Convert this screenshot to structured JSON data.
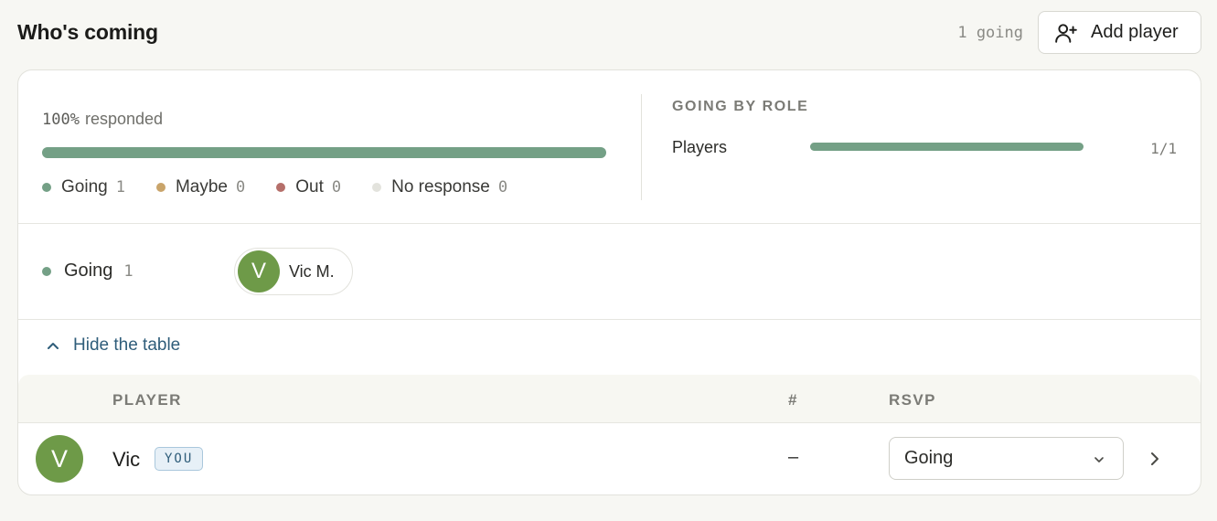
{
  "header": {
    "title": "Who's coming",
    "going_count": "1 going",
    "add_player_label": "Add player"
  },
  "summary": {
    "percent": "100%",
    "responded_label": "responded",
    "responded_fraction": 1.0,
    "legend": [
      {
        "label": "Going",
        "count": "1",
        "color": "#74a086"
      },
      {
        "label": "Maybe",
        "count": "0",
        "color": "#c9a46a"
      },
      {
        "label": "Out",
        "count": "0",
        "color": "#b56f6a"
      },
      {
        "label": "No response",
        "count": "0",
        "color": "#e3e3dd"
      }
    ]
  },
  "roles": {
    "heading": "GOING BY ROLE",
    "items": [
      {
        "name": "Players",
        "count": "1/1",
        "fraction": 1.0
      }
    ]
  },
  "groups": [
    {
      "label": "Going",
      "count": "1",
      "color": "#74a086",
      "members": [
        {
          "initial": "V",
          "name": "Vic M."
        }
      ]
    }
  ],
  "table_toggle": "Hide the table",
  "table": {
    "headers": {
      "player": "PLAYER",
      "number": "#",
      "rsvp": "RSVP"
    },
    "rows": [
      {
        "initial": "V",
        "name": "Vic",
        "badge": "YOU",
        "number": "–",
        "rsvp": "Going"
      }
    ]
  },
  "colors": {
    "accent_green": "#74a086",
    "avatar_green": "#6e9a48",
    "link_blue": "#2f5d7a"
  }
}
